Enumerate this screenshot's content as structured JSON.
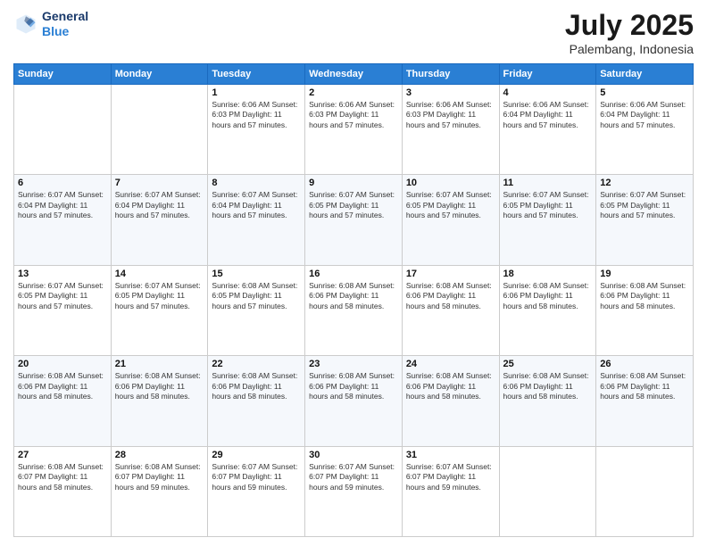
{
  "logo": {
    "line1": "General",
    "line2": "Blue"
  },
  "title": "July 2025",
  "location": "Palembang, Indonesia",
  "days_header": [
    "Sunday",
    "Monday",
    "Tuesday",
    "Wednesday",
    "Thursday",
    "Friday",
    "Saturday"
  ],
  "weeks": [
    [
      {
        "day": "",
        "info": ""
      },
      {
        "day": "",
        "info": ""
      },
      {
        "day": "1",
        "info": "Sunrise: 6:06 AM\nSunset: 6:03 PM\nDaylight: 11 hours and 57 minutes."
      },
      {
        "day": "2",
        "info": "Sunrise: 6:06 AM\nSunset: 6:03 PM\nDaylight: 11 hours and 57 minutes."
      },
      {
        "day": "3",
        "info": "Sunrise: 6:06 AM\nSunset: 6:03 PM\nDaylight: 11 hours and 57 minutes."
      },
      {
        "day": "4",
        "info": "Sunrise: 6:06 AM\nSunset: 6:04 PM\nDaylight: 11 hours and 57 minutes."
      },
      {
        "day": "5",
        "info": "Sunrise: 6:06 AM\nSunset: 6:04 PM\nDaylight: 11 hours and 57 minutes."
      }
    ],
    [
      {
        "day": "6",
        "info": "Sunrise: 6:07 AM\nSunset: 6:04 PM\nDaylight: 11 hours and 57 minutes."
      },
      {
        "day": "7",
        "info": "Sunrise: 6:07 AM\nSunset: 6:04 PM\nDaylight: 11 hours and 57 minutes."
      },
      {
        "day": "8",
        "info": "Sunrise: 6:07 AM\nSunset: 6:04 PM\nDaylight: 11 hours and 57 minutes."
      },
      {
        "day": "9",
        "info": "Sunrise: 6:07 AM\nSunset: 6:05 PM\nDaylight: 11 hours and 57 minutes."
      },
      {
        "day": "10",
        "info": "Sunrise: 6:07 AM\nSunset: 6:05 PM\nDaylight: 11 hours and 57 minutes."
      },
      {
        "day": "11",
        "info": "Sunrise: 6:07 AM\nSunset: 6:05 PM\nDaylight: 11 hours and 57 minutes."
      },
      {
        "day": "12",
        "info": "Sunrise: 6:07 AM\nSunset: 6:05 PM\nDaylight: 11 hours and 57 minutes."
      }
    ],
    [
      {
        "day": "13",
        "info": "Sunrise: 6:07 AM\nSunset: 6:05 PM\nDaylight: 11 hours and 57 minutes."
      },
      {
        "day": "14",
        "info": "Sunrise: 6:07 AM\nSunset: 6:05 PM\nDaylight: 11 hours and 57 minutes."
      },
      {
        "day": "15",
        "info": "Sunrise: 6:08 AM\nSunset: 6:05 PM\nDaylight: 11 hours and 57 minutes."
      },
      {
        "day": "16",
        "info": "Sunrise: 6:08 AM\nSunset: 6:06 PM\nDaylight: 11 hours and 58 minutes."
      },
      {
        "day": "17",
        "info": "Sunrise: 6:08 AM\nSunset: 6:06 PM\nDaylight: 11 hours and 58 minutes."
      },
      {
        "day": "18",
        "info": "Sunrise: 6:08 AM\nSunset: 6:06 PM\nDaylight: 11 hours and 58 minutes."
      },
      {
        "day": "19",
        "info": "Sunrise: 6:08 AM\nSunset: 6:06 PM\nDaylight: 11 hours and 58 minutes."
      }
    ],
    [
      {
        "day": "20",
        "info": "Sunrise: 6:08 AM\nSunset: 6:06 PM\nDaylight: 11 hours and 58 minutes."
      },
      {
        "day": "21",
        "info": "Sunrise: 6:08 AM\nSunset: 6:06 PM\nDaylight: 11 hours and 58 minutes."
      },
      {
        "day": "22",
        "info": "Sunrise: 6:08 AM\nSunset: 6:06 PM\nDaylight: 11 hours and 58 minutes."
      },
      {
        "day": "23",
        "info": "Sunrise: 6:08 AM\nSunset: 6:06 PM\nDaylight: 11 hours and 58 minutes."
      },
      {
        "day": "24",
        "info": "Sunrise: 6:08 AM\nSunset: 6:06 PM\nDaylight: 11 hours and 58 minutes."
      },
      {
        "day": "25",
        "info": "Sunrise: 6:08 AM\nSunset: 6:06 PM\nDaylight: 11 hours and 58 minutes."
      },
      {
        "day": "26",
        "info": "Sunrise: 6:08 AM\nSunset: 6:06 PM\nDaylight: 11 hours and 58 minutes."
      }
    ],
    [
      {
        "day": "27",
        "info": "Sunrise: 6:08 AM\nSunset: 6:07 PM\nDaylight: 11 hours and 58 minutes."
      },
      {
        "day": "28",
        "info": "Sunrise: 6:08 AM\nSunset: 6:07 PM\nDaylight: 11 hours and 59 minutes."
      },
      {
        "day": "29",
        "info": "Sunrise: 6:07 AM\nSunset: 6:07 PM\nDaylight: 11 hours and 59 minutes."
      },
      {
        "day": "30",
        "info": "Sunrise: 6:07 AM\nSunset: 6:07 PM\nDaylight: 11 hours and 59 minutes."
      },
      {
        "day": "31",
        "info": "Sunrise: 6:07 AM\nSunset: 6:07 PM\nDaylight: 11 hours and 59 minutes."
      },
      {
        "day": "",
        "info": ""
      },
      {
        "day": "",
        "info": ""
      }
    ]
  ]
}
